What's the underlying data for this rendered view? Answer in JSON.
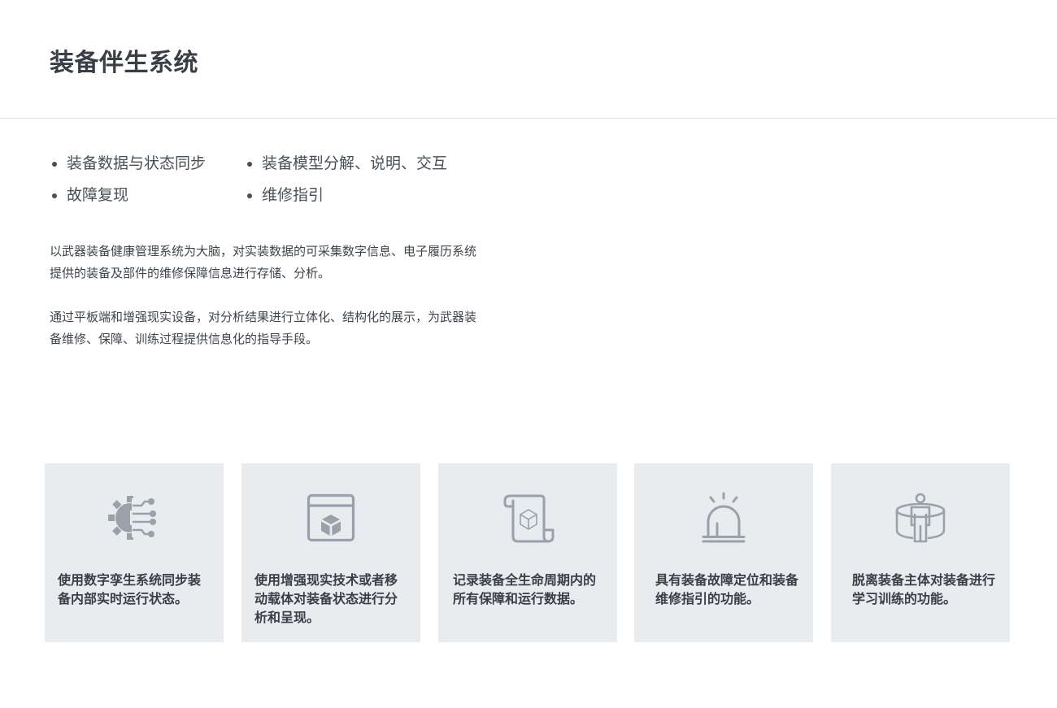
{
  "page": {
    "title": "装备伴生系统"
  },
  "features": [
    "装备数据与状态同步",
    "装备模型分解、说明、交互",
    "故障复现",
    "维修指引"
  ],
  "descriptions": [
    "以武器装备健康管理系统为大脑，对实装数据的可采集数字信息、电子履历系统提供的装备及部件的维修保障信息进行存储、分析。",
    "通过平板端和增强现实设备，对分析结果进行立体化、结构化的展示，为武器装备维修、保障、训练过程提供信息化的指导手段。"
  ],
  "cards": [
    {
      "icon": "gear-circuit-icon",
      "text": "使用数字孪生系统同步装备内部实时运行状态。"
    },
    {
      "icon": "window-cube-icon",
      "text": "使用增强现实技术或者移动载体对装备状态进行分析和呈现。"
    },
    {
      "icon": "scroll-cube-icon",
      "text": "记录装备全生命周期内的所有保障和运行数据。"
    },
    {
      "icon": "alarm-light-icon",
      "text": "具有装备故障定位和装备维修指引的功能。"
    },
    {
      "icon": "person-cylinder-icon",
      "text": "脱离装备主体对装备进行学习训练的功能。"
    }
  ],
  "colors": {
    "icon": "#9aa1a9",
    "card_background": "#e8ecef",
    "text": "#3a3f45",
    "divider": "#dcdfe3"
  }
}
